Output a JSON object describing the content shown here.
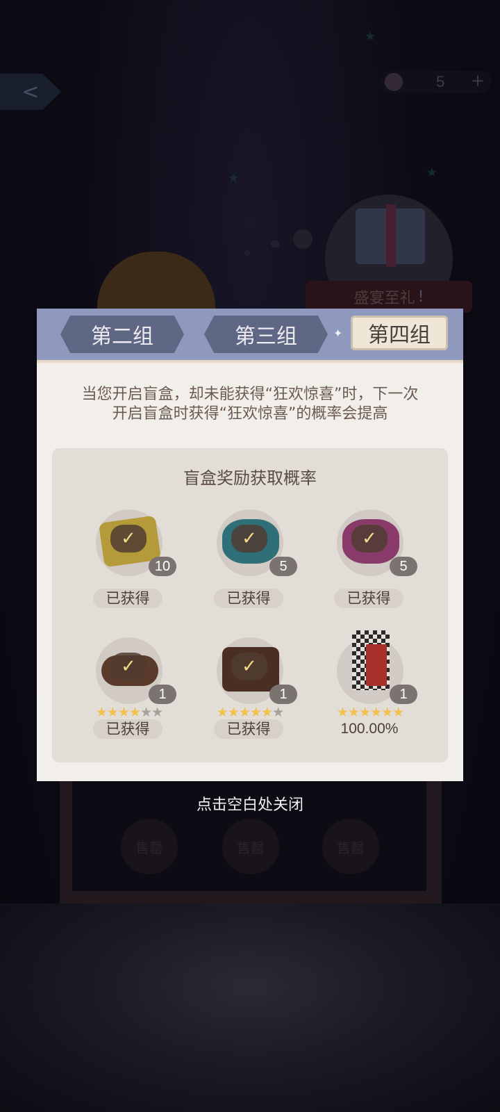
{
  "header": {
    "back_icon": "back-arrow-icon",
    "currency": {
      "icon": "feather-coin-icon",
      "value": "5",
      "plus": "+"
    }
  },
  "background": {
    "gift_banner": "盛宴至礼",
    "gift_alert": "!",
    "sold_label": "售罄"
  },
  "dialog": {
    "tabs": [
      {
        "label": "第二组",
        "active": false
      },
      {
        "label": "第三组",
        "active": false
      },
      {
        "label": "第四组",
        "active": true
      }
    ],
    "description_line1": "当您开启盲盒，却未能获得“狂欢惊喜”时，下一次",
    "description_line2": "开启盲盒时获得“狂欢惊喜”的概率会提高",
    "panel_title": "盲盒奖励获取概率",
    "items": [
      {
        "name": "golden ticket",
        "count": "10",
        "obtained": true,
        "status": "已获得",
        "stars": 0,
        "max_stars": 0
      },
      {
        "name": "blue star potion",
        "count": "5",
        "obtained": true,
        "status": "已获得",
        "stars": 0,
        "max_stars": 0
      },
      {
        "name": "purple star potion",
        "count": "5",
        "obtained": true,
        "status": "已获得",
        "stars": 0,
        "max_stars": 0
      },
      {
        "name": "leather bracelet",
        "count": "1",
        "obtained": true,
        "status": "已获得",
        "stars": 4,
        "max_stars": 6
      },
      {
        "name": "chocolate bag",
        "count": "1",
        "obtained": true,
        "status": "已获得",
        "stars": 5,
        "max_stars": 6
      },
      {
        "name": "checkered gown",
        "count": "1",
        "obtained": false,
        "status": "100.00%",
        "stars": 6,
        "max_stars": 6
      }
    ]
  },
  "close_hint": "点击空白处关闭",
  "colors": {
    "tab_bar": "#8e99bd",
    "tab_inactive": "#5e6784",
    "tab_active": "#efe6d8",
    "panel": "#e3ddd7",
    "star_on": "#f0c24a",
    "star_off": "#a6a09c"
  }
}
